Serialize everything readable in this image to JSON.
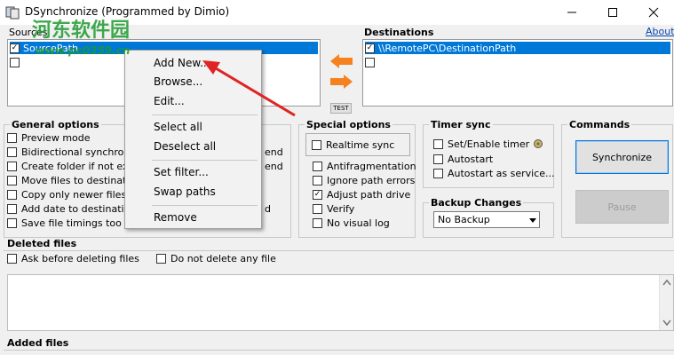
{
  "window": {
    "title": "DSynchronize (Programmed by Dimio)"
  },
  "watermark": {
    "text": "河东软件园",
    "url": "www.pc0359.cn"
  },
  "sources": {
    "label": "Sources",
    "items": [
      {
        "text": "SourcePath",
        "checked": true,
        "selected": true
      },
      {
        "text": "",
        "checked": false,
        "selected": false
      }
    ]
  },
  "destinations": {
    "label": "Destinations",
    "about": "About",
    "items": [
      {
        "text": "\\\\RemotePC\\DestinationPath",
        "checked": true,
        "selected": true
      },
      {
        "text": "",
        "checked": false,
        "selected": false
      }
    ]
  },
  "center": {
    "test_label": "TEST"
  },
  "context_menu": {
    "items": [
      "Add New...",
      "Browse...",
      "Edit...",
      "Select all",
      "Deselect all",
      "Set filter...",
      "Swap paths",
      "Remove"
    ]
  },
  "general_options": {
    "label": "General options",
    "items": [
      {
        "text": "Preview mode",
        "checked": false
      },
      {
        "text": "Bidirectional synchronize",
        "checked": false
      },
      {
        "text": "Create folder if not exist",
        "checked": false
      },
      {
        "text": "Move files to destination",
        "checked": false
      },
      {
        "text": "Copy only newer files",
        "checked": false
      },
      {
        "text": "Add date to destination",
        "checked": false
      },
      {
        "text": "Save file timings too",
        "checked": false
      }
    ],
    "hidden_fragments": [
      "end",
      "end",
      "d"
    ]
  },
  "special_options": {
    "label": "Special options",
    "realtime": "Realtime sync",
    "items": [
      {
        "text": "Antifragmentation",
        "checked": false
      },
      {
        "text": "Ignore path errors",
        "checked": false
      },
      {
        "text": "Adjust path drive",
        "checked": true
      },
      {
        "text": "Verify",
        "checked": false
      },
      {
        "text": "No visual log",
        "checked": false
      }
    ]
  },
  "timer_sync": {
    "label": "Timer sync",
    "items": [
      {
        "text": "Set/Enable timer",
        "checked": false
      },
      {
        "text": "Autostart",
        "checked": false
      },
      {
        "text": "Autostart as service...",
        "checked": false
      }
    ]
  },
  "backup_changes": {
    "label": "Backup Changes",
    "selected": "No Backup"
  },
  "commands": {
    "label": "Commands",
    "synchronize": "Synchronize",
    "pause": "Pause"
  },
  "deleted_files": {
    "label": "Deleted files",
    "ask": "Ask before deleting files",
    "donot": "Do not delete any file"
  },
  "added_files": {
    "label": "Added files"
  },
  "colors": {
    "selection": "#0078d7",
    "arrow_orange": "#f5821f",
    "annotation_red": "#e02424",
    "watermark_green": "#1e9a2f"
  }
}
